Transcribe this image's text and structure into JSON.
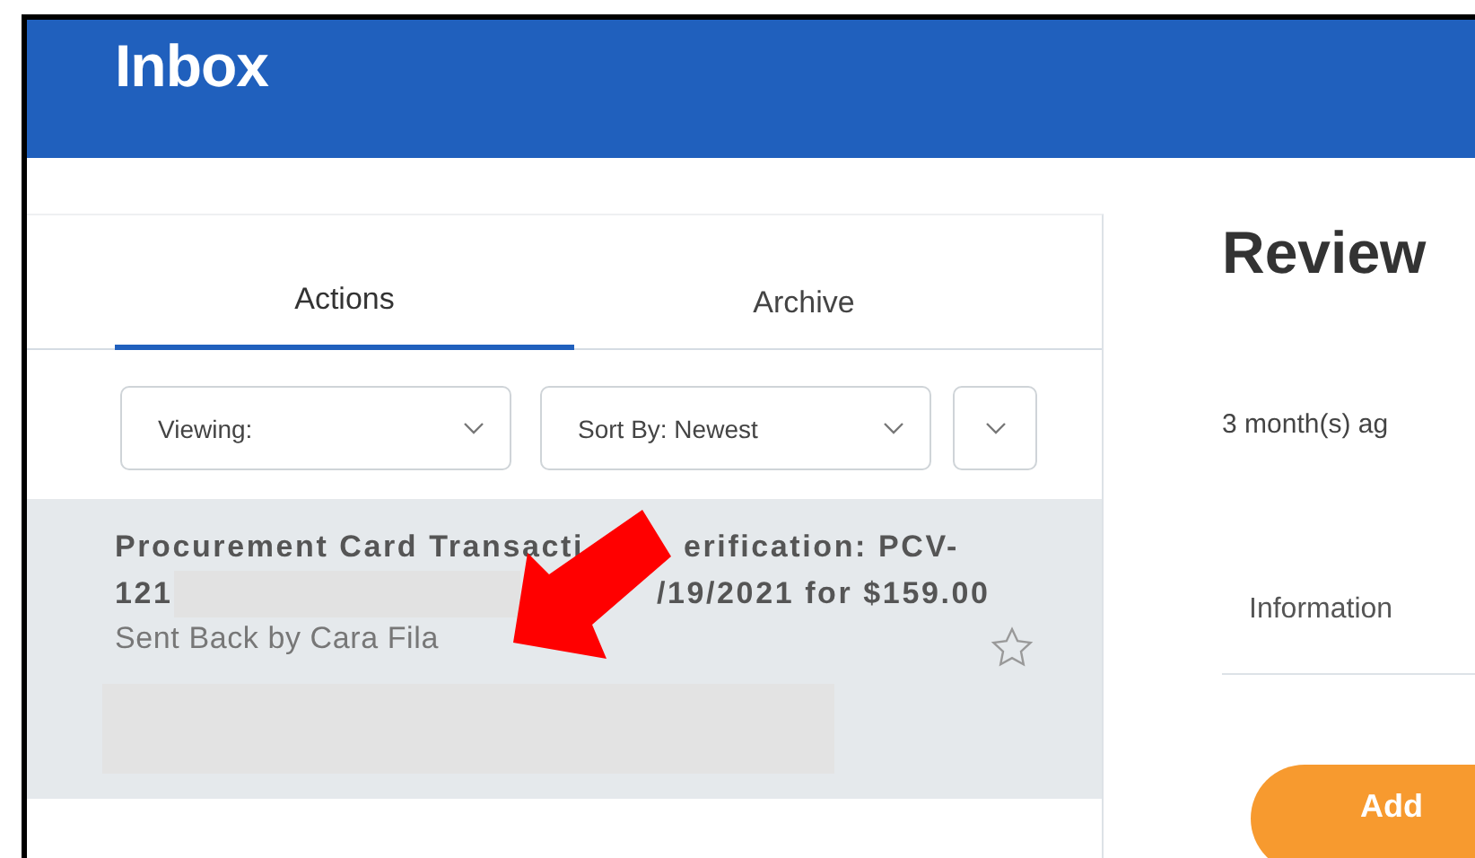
{
  "header": {
    "title": "Inbox"
  },
  "tabs": [
    {
      "label": "Actions",
      "selected": true
    },
    {
      "label": "Archive",
      "selected": false
    }
  ],
  "filters": [
    {
      "kind": "select",
      "label": "Viewing:"
    },
    {
      "kind": "select",
      "label": "Sort By: Newest"
    },
    {
      "kind": "menu"
    }
  ],
  "items": [
    {
      "title_parts": [
        "Procurement Card Transacti",
        "erification: PCV-"
      ],
      "line2_parts": [
        "121",
        "/19/2021 for $159.00"
      ],
      "subtitle": "Sent Back by Cara Fila",
      "selected": true
    }
  ],
  "detail": {
    "title": "Review",
    "age": "3 month(s) ag",
    "tab": "Information",
    "button": "Add"
  }
}
